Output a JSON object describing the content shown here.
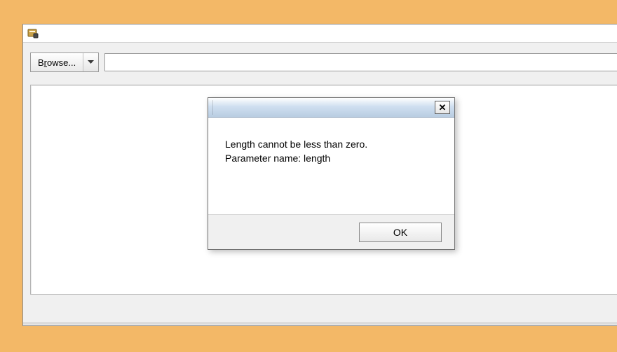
{
  "window": {
    "title": ""
  },
  "toolbar": {
    "browse_prefix": "B",
    "browse_accesskey": "r",
    "browse_suffix": "owse...",
    "path_value": "",
    "path_placeholder": ""
  },
  "dialog": {
    "title": "",
    "message_line1": "Length cannot be less than zero.",
    "message_line2": "Parameter name: length",
    "ok_label": "OK",
    "close_glyph": "✕"
  }
}
